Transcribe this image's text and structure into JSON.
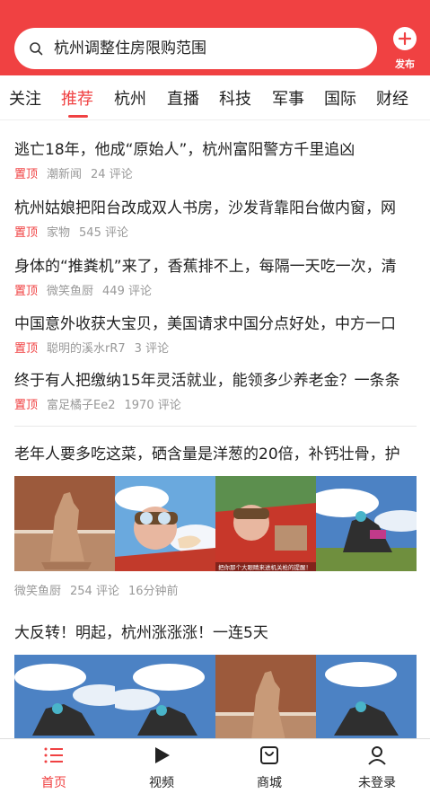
{
  "header": {
    "search_text": "杭州调整住房限购范围",
    "publish_label": "发布",
    "accent_color": "#f04142"
  },
  "tabs": [
    {
      "label": "关注"
    },
    {
      "label": "推荐",
      "active": true
    },
    {
      "label": "杭州"
    },
    {
      "label": "直播"
    },
    {
      "label": "科技"
    },
    {
      "label": "军事"
    },
    {
      "label": "国际"
    },
    {
      "label": "财经"
    }
  ],
  "pinned_news": [
    {
      "title": "逃亡18年，他成“原始人”，杭州富阳警方千里追凶",
      "pin": "置顶",
      "source": "潮新闻",
      "comments": "24 评论"
    },
    {
      "title": "杭州姑娘把阳台改成双人书房，沙发背靠阳台做内窗，网",
      "pin": "置顶",
      "source": "家物",
      "comments": "545 评论"
    },
    {
      "title": "身体的“推粪机”来了，香蕉排不上，每隔一天吃一次，清",
      "pin": "置顶",
      "source": "微笑鱼厨",
      "comments": "449 评论"
    },
    {
      "title": "中国意外收获大宝贝，美国请求中国分点好处，中方一口",
      "pin": "置顶",
      "source": "聪明的溪水rR7",
      "comments": "3 评论"
    },
    {
      "title": "终于有人把缴纳15年灵活就业，能领多少养老金？一条条",
      "pin": "置顶",
      "source": "富足橘子Ee2",
      "comments": "1970 评论"
    }
  ],
  "image_news": [
    {
      "title": "老年人要多吃这菜，硒含量是洋葱的20倍，补钙壮骨，护",
      "source": "微笑鱼厨",
      "comments": "254 评论",
      "time": "16分钟前",
      "caption": "把你那个大眼睛来进机关枪的提醒！",
      "thumbs": [
        "statue-image",
        "cartoon-pilot-image",
        "cartoon-plane-image",
        "yoga-image"
      ]
    },
    {
      "title": "大反转！明起，杭州涨涨涨！一连5天",
      "thumbs": [
        "yoga-image",
        "yoga-image",
        "statue-image",
        "yoga-image"
      ]
    }
  ],
  "bottom_nav": [
    {
      "label": "首页",
      "icon": "list-icon",
      "active": true
    },
    {
      "label": "视频",
      "icon": "play-icon"
    },
    {
      "label": "商城",
      "icon": "shop-icon"
    },
    {
      "label": "未登录",
      "icon": "user-icon"
    }
  ]
}
